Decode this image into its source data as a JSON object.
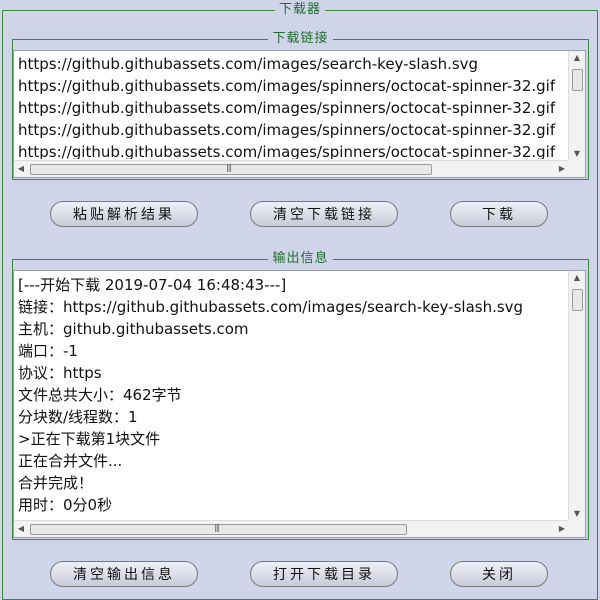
{
  "window": {
    "title": "下载器"
  },
  "links_section": {
    "title": "下载链接",
    "lines": [
      "https://github.githubassets.com/images/search-key-slash.svg",
      "https://github.githubassets.com/images/spinners/octocat-spinner-32.gif",
      "https://github.githubassets.com/images/spinners/octocat-spinner-32.gif",
      "https://github.githubassets.com/images/spinners/octocat-spinner-32.gif",
      "https://github.githubassets.com/images/spinners/octocat-spinner-32.gif"
    ]
  },
  "top_buttons": {
    "paste": "粘贴解析结果",
    "clear_links": "清空下载链接",
    "download": "下载"
  },
  "output_section": {
    "title": "输出信息",
    "lines": [
      "[---开始下载 2019-07-04 16:48:43---]",
      "链接：https://github.githubassets.com/images/search-key-slash.svg",
      "主机：github.githubassets.com",
      "端口：-1",
      "协议：https",
      "文件总共大小：462字节",
      "分块数/线程数：1",
      ">正在下载第1块文件",
      "正在合并文件...",
      "合并完成！",
      "用时：0分0秒"
    ]
  },
  "bottom_buttons": {
    "clear_output": "清空输出信息",
    "open_dir": "打开下载目录",
    "close": "关闭"
  }
}
